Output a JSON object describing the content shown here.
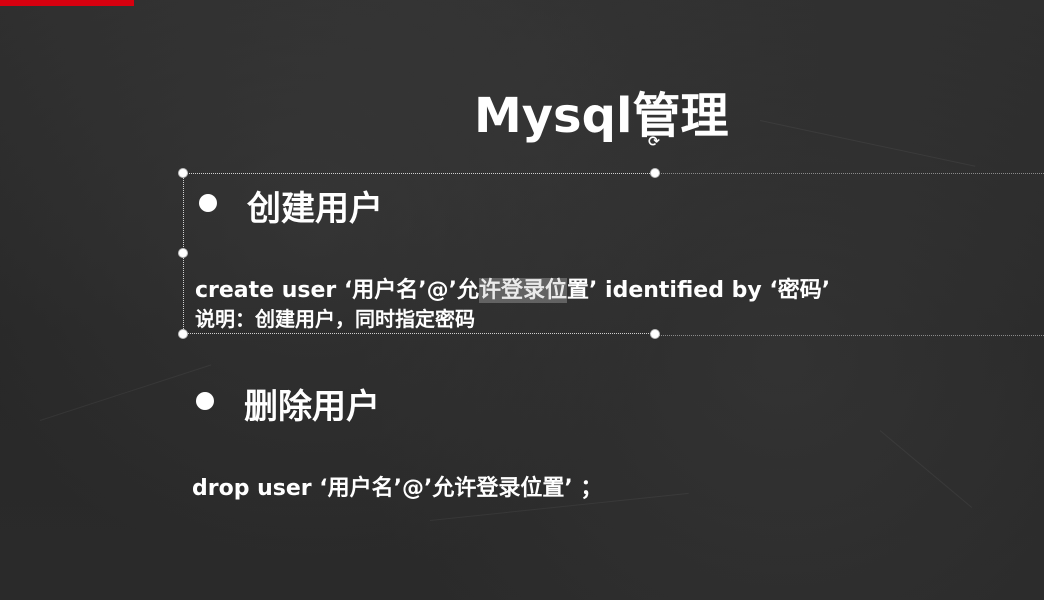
{
  "slide": {
    "title": "Mysql管理",
    "section1": {
      "heading": "创建用户",
      "code_part1": "create  user   ‘用户名’@’允",
      "code_highlight": "许登录位",
      "code_part2": "置’   identified  by   ‘密码’",
      "description": "说明：创建用户，同时指定密码"
    },
    "section2": {
      "heading": "删除用户",
      "code": "drop  user   ‘用户名’@’允许登录位置’ ；"
    }
  },
  "icons": {
    "rotate": "rotate-handle-icon",
    "bullet": "bullet-icon"
  },
  "colors": {
    "accent_red": "#d7000f",
    "background": "#2b2b2b",
    "text": "#ffffff"
  }
}
